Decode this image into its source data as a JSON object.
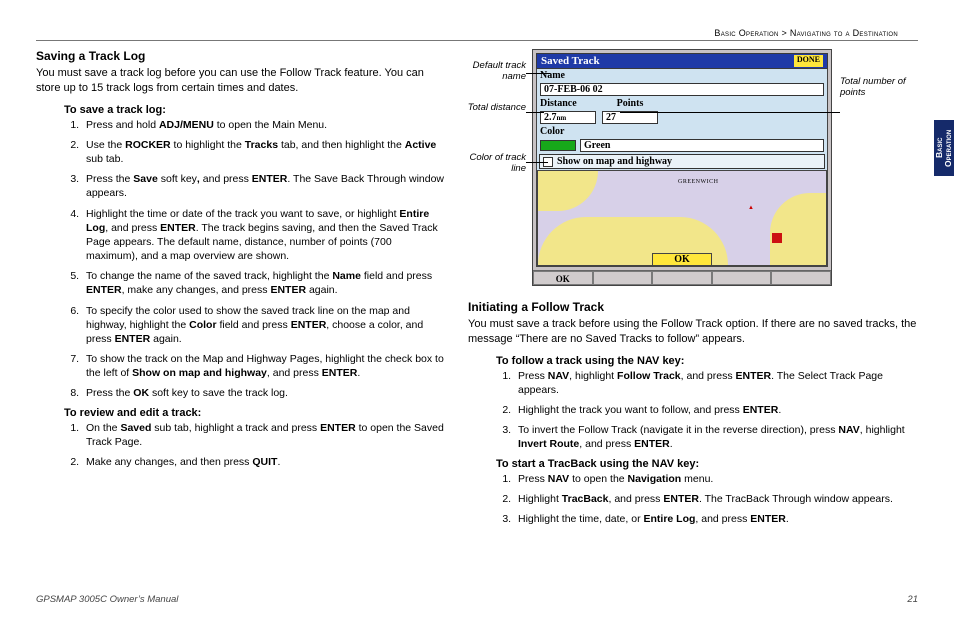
{
  "breadcrumb": {
    "section": "Basic Operation",
    "sep": " > ",
    "subsection": "Navigating to a Destination"
  },
  "sideTab": "Basic Operation",
  "left": {
    "h1": "Saving a Track Log",
    "intro": "You must save a track log before you can use the Follow Track feature. You can store up to 15 track logs from certain times and dates.",
    "sub1": "To save a track log:",
    "steps1": [
      "Press and hold <b>ADJ/MENU</b> to open the Main Menu.",
      "Use the <b>ROCKER</b> to highlight the <b>Tracks</b> tab, and then highlight the <b>Active</b> sub tab.",
      "Press the <b>Save</b> soft key<b>,</b> and press <b>ENTER</b>. The Save Back Through window appears.",
      "Highlight the time or date of the track you want to save, or highlight <b>Entire Log</b>, and press <b>ENTER</b>. The track begins saving, and then the Saved Track Page appears. The default name, distance, number of points (700 maximum), and a map overview are shown.",
      "To change the name of the saved track, highlight the <b>Name</b> field and press <b>ENTER</b>, make any changes, and press <b>ENTER</b> again.",
      "To specify the color used to show the saved track line on the map and highway, highlight the <b>Color</b> field and press <b>ENTER</b>, choose a color, and press <b>ENTER</b> again.",
      "To show the track on the Map and Highway Pages, highlight the check box to the left of <b>Show on map and highway</b>, and press <b>ENTER</b>.",
      "Press the <b>OK</b> soft key to save the track log."
    ],
    "sub2": "To review and edit a track:",
    "steps2": [
      "On the <b>Saved</b> sub tab, highlight a track and press <b>ENTER</b> to open the Saved Track Page.",
      "Make any changes, and then press <b>QUIT</b>."
    ]
  },
  "figure": {
    "callouts": {
      "defaultName": "Default track name",
      "totalDistance": "Total distance",
      "colorLine": "Color of track line",
      "totalPoints": "Total number of points"
    },
    "screen": {
      "title": "Saved Track",
      "done": "DONE",
      "nameLabel": "Name",
      "nameValue": "07-FEB-06 02",
      "distanceLabel": "Distance",
      "distanceValue": "2.7",
      "distanceUnit": "nm",
      "pointsLabel": "Points",
      "pointsValue": "27",
      "colorLabel": "Color",
      "colorValue": "Green",
      "showLabel": "Show on map and highway",
      "greenwich": "GREENWICH",
      "okMap": "OK",
      "okSoft": "OK"
    }
  },
  "right": {
    "h1": "Initiating a Follow Track",
    "intro": "You must save a track before using the Follow Track option. If there are no saved tracks, the message “There are no Saved Tracks to follow” appears.",
    "sub1": "To follow a track using the NAV key:",
    "steps1": [
      "Press <b>NAV</b>, highlight <b>Follow Track</b>, and press <b>ENTER</b>. The Select Track Page appears.",
      "Highlight the track you want to follow, and press <b>ENTER</b>.",
      "To invert the Follow Track (navigate it in the reverse direction), press <b>NAV</b>, highlight <b>Invert Route</b>, and press <b>ENTER</b>."
    ],
    "sub2": "To start a TracBack using the NAV key:",
    "steps2": [
      "Press <b>NAV</b> to open the <b>Navigation</b> menu.",
      "Highlight <b>TracBack</b>, and press <b>ENTER</b>. The TracBack Through window appears.",
      "Highlight the time, date, or <b>Entire Log</b>, and press <b>ENTER</b>."
    ]
  },
  "footer": {
    "manual": "GPSMAP 3005C Owner’s Manual",
    "page": "21"
  }
}
